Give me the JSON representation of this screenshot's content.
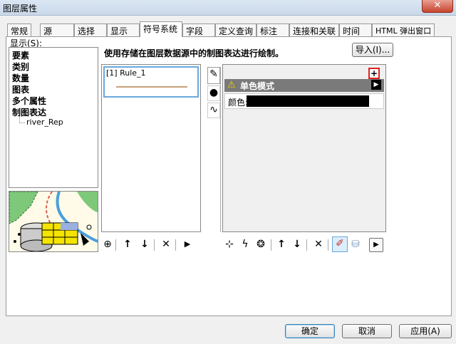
{
  "window": {
    "title": "图层属性",
    "close_label": "✕"
  },
  "tabs": [
    {
      "label": "常规"
    },
    {
      "label": "源"
    },
    {
      "label": "选择"
    },
    {
      "label": "显示"
    },
    {
      "label": "符号系统"
    },
    {
      "label": "字段"
    },
    {
      "label": "定义查询"
    },
    {
      "label": "标注"
    },
    {
      "label": "连接和关联"
    },
    {
      "label": "时间"
    },
    {
      "label": "HTML 弹出窗口"
    }
  ],
  "show_label": "显示(S):",
  "categories": [
    "要素",
    "类别",
    "数量",
    "图表",
    "多个属性",
    "制图表达"
  ],
  "sub_item": "river_Rep",
  "description": "使用存储在图层数据源中的制图表达进行绘制。",
  "import_button": "导入(I)...",
  "rule_item": "[1] Rule_1",
  "mode_label": "单色模式",
  "color_label": "颜色:",
  "colors": {
    "rule_line": "#c8a07a",
    "mode_header": "#7a7a7a",
    "swatch": "#000000"
  },
  "buttons": {
    "ok": "确定",
    "cancel": "取消",
    "apply": "应用(A)"
  }
}
